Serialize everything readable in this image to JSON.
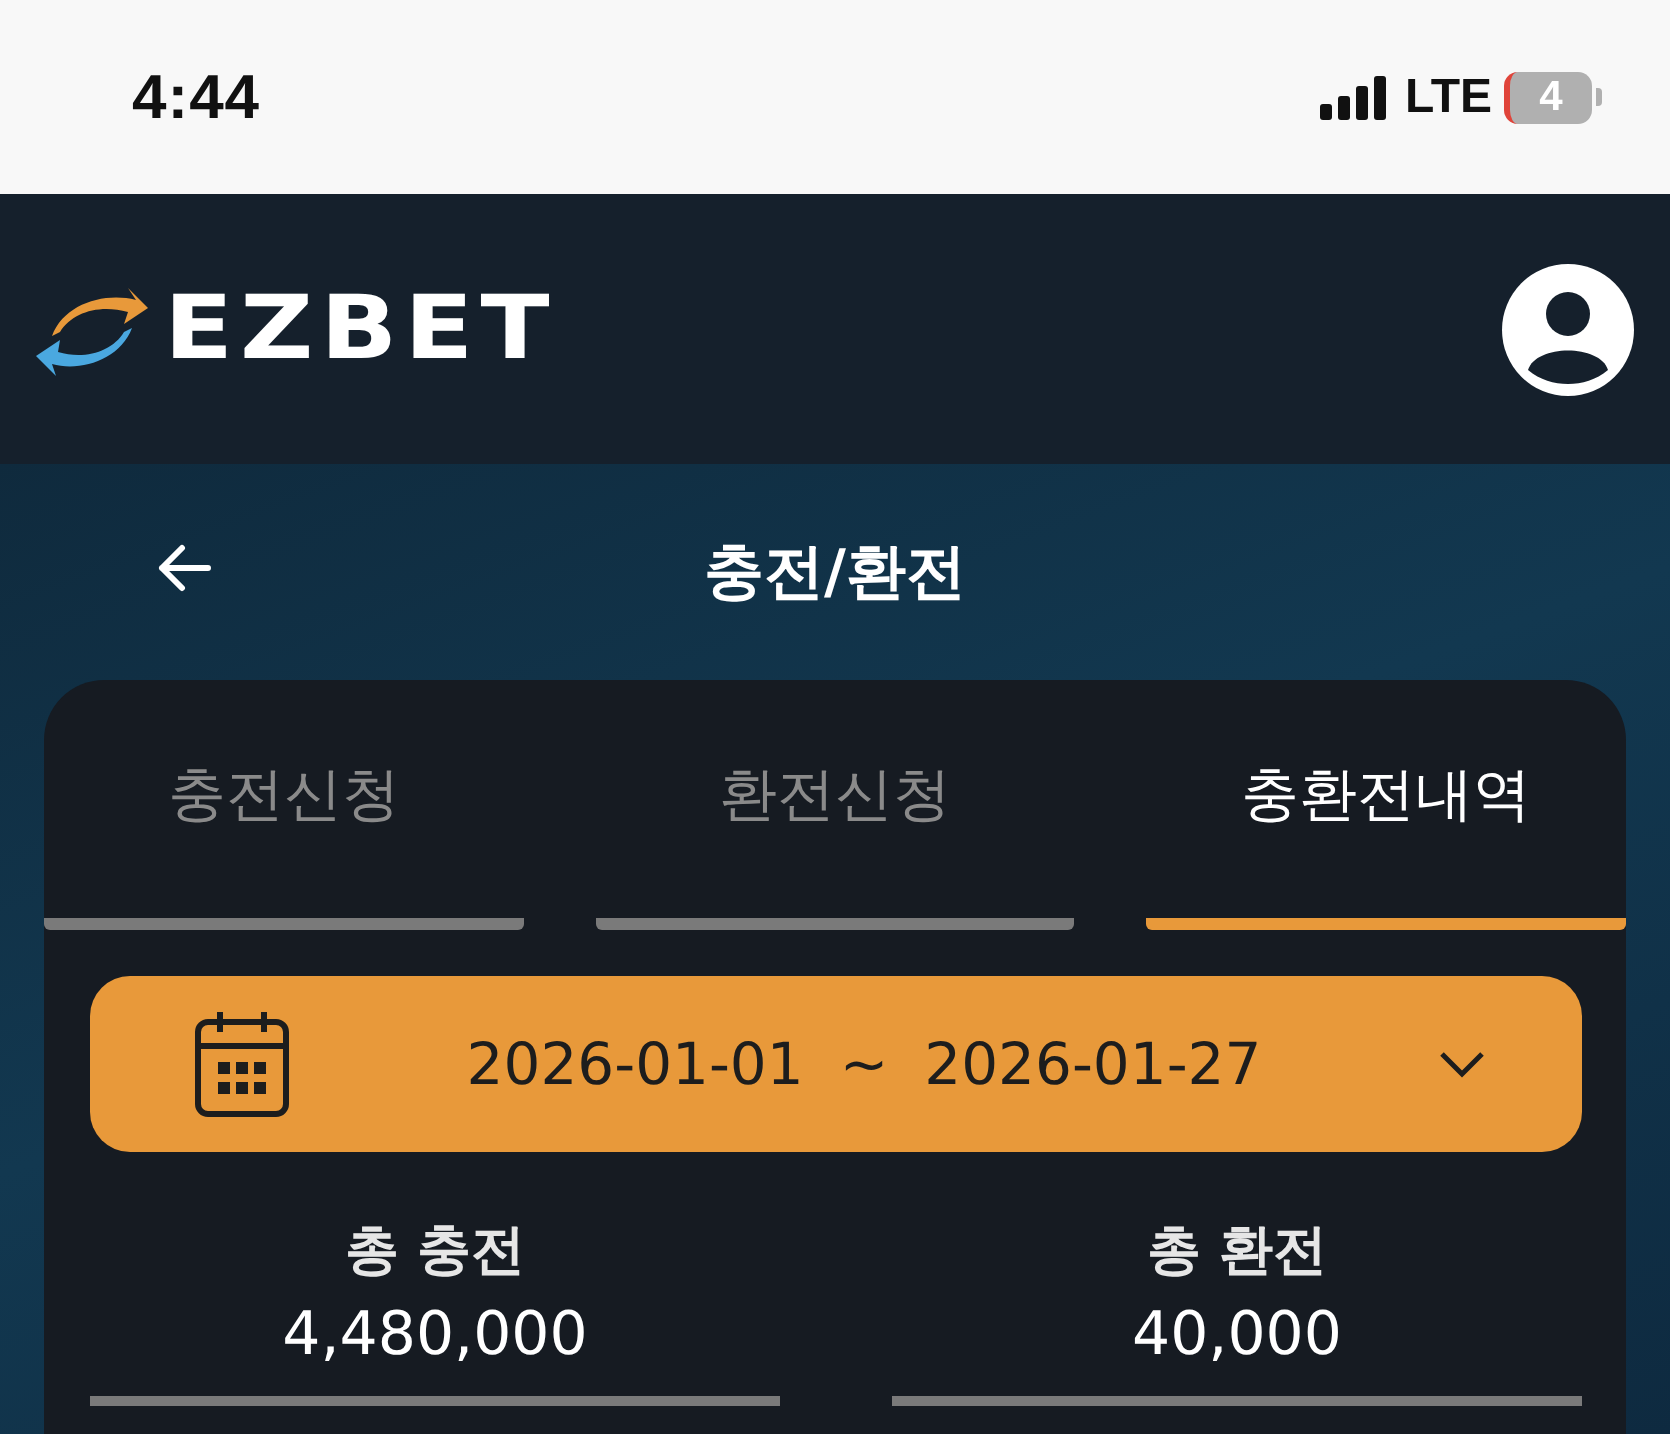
{
  "status_bar": {
    "time": "4:44",
    "network": "LTE",
    "battery": "4"
  },
  "header": {
    "logo": "EZBET"
  },
  "page": {
    "title": "충전/환전"
  },
  "tabs": [
    {
      "label": "충전신청",
      "selected": false
    },
    {
      "label": "환전신청",
      "selected": false
    },
    {
      "label": "충환전내역",
      "selected": true
    }
  ],
  "date_range": {
    "start": "2026-01-01",
    "separator": "~",
    "end": "2026-01-27"
  },
  "totals": [
    {
      "label": "총 충전",
      "value": "4,480,000"
    },
    {
      "label": "총 환전",
      "value": "40,000"
    }
  ]
}
